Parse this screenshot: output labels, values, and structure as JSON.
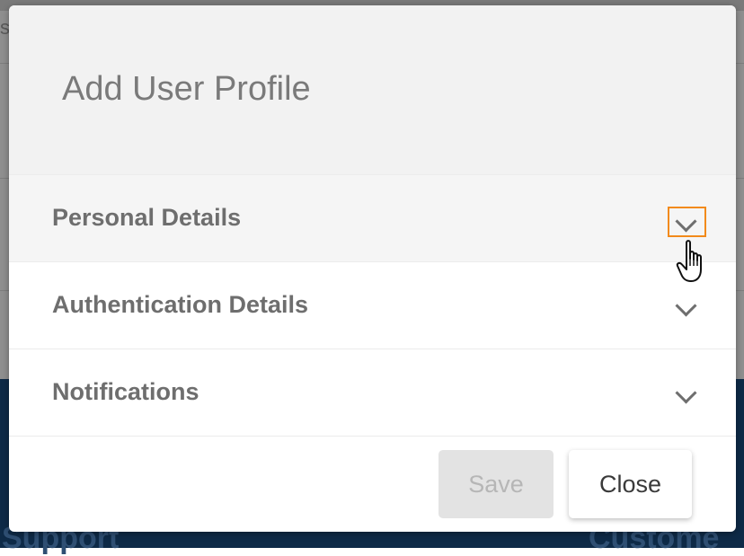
{
  "background": {
    "fragment_text": "s",
    "footer_left": "Support",
    "footer_right": "Custome"
  },
  "modal": {
    "title": "Add User Profile",
    "sections": [
      {
        "label": "Personal Details",
        "icon": "chevron-down-icon",
        "expanded": false
      },
      {
        "label": "Authentication Details",
        "icon": "chevron-down-icon",
        "expanded": false
      },
      {
        "label": "Notifications",
        "icon": "chevron-down-icon",
        "expanded": false
      }
    ],
    "buttons": {
      "save_label": "Save",
      "save_disabled": true,
      "close_label": "Close"
    }
  },
  "colors": {
    "highlight": "#f28a1b",
    "background_band": "#0e2a47"
  },
  "cursor": {
    "icon": "hand-pointer-icon"
  }
}
